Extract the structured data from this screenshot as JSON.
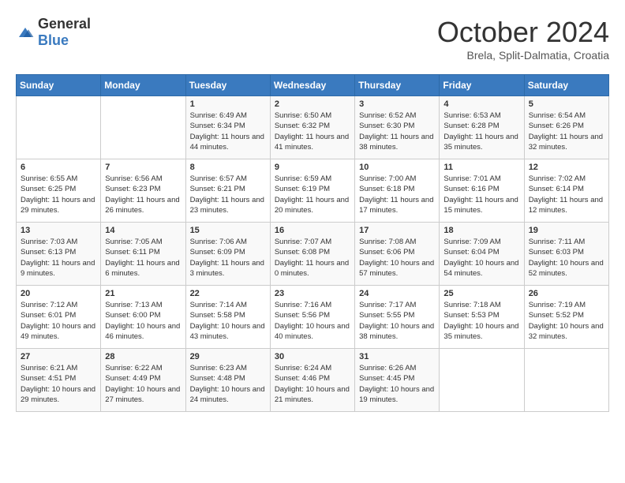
{
  "header": {
    "logo_general": "General",
    "logo_blue": "Blue",
    "month": "October 2024",
    "location": "Brela, Split-Dalmatia, Croatia"
  },
  "days_of_week": [
    "Sunday",
    "Monday",
    "Tuesday",
    "Wednesday",
    "Thursday",
    "Friday",
    "Saturday"
  ],
  "weeks": [
    [
      {
        "day": "",
        "content": ""
      },
      {
        "day": "",
        "content": ""
      },
      {
        "day": "1",
        "content": "Sunrise: 6:49 AM\nSunset: 6:34 PM\nDaylight: 11 hours and 44 minutes."
      },
      {
        "day": "2",
        "content": "Sunrise: 6:50 AM\nSunset: 6:32 PM\nDaylight: 11 hours and 41 minutes."
      },
      {
        "day": "3",
        "content": "Sunrise: 6:52 AM\nSunset: 6:30 PM\nDaylight: 11 hours and 38 minutes."
      },
      {
        "day": "4",
        "content": "Sunrise: 6:53 AM\nSunset: 6:28 PM\nDaylight: 11 hours and 35 minutes."
      },
      {
        "day": "5",
        "content": "Sunrise: 6:54 AM\nSunset: 6:26 PM\nDaylight: 11 hours and 32 minutes."
      }
    ],
    [
      {
        "day": "6",
        "content": "Sunrise: 6:55 AM\nSunset: 6:25 PM\nDaylight: 11 hours and 29 minutes."
      },
      {
        "day": "7",
        "content": "Sunrise: 6:56 AM\nSunset: 6:23 PM\nDaylight: 11 hours and 26 minutes."
      },
      {
        "day": "8",
        "content": "Sunrise: 6:57 AM\nSunset: 6:21 PM\nDaylight: 11 hours and 23 minutes."
      },
      {
        "day": "9",
        "content": "Sunrise: 6:59 AM\nSunset: 6:19 PM\nDaylight: 11 hours and 20 minutes."
      },
      {
        "day": "10",
        "content": "Sunrise: 7:00 AM\nSunset: 6:18 PM\nDaylight: 11 hours and 17 minutes."
      },
      {
        "day": "11",
        "content": "Sunrise: 7:01 AM\nSunset: 6:16 PM\nDaylight: 11 hours and 15 minutes."
      },
      {
        "day": "12",
        "content": "Sunrise: 7:02 AM\nSunset: 6:14 PM\nDaylight: 11 hours and 12 minutes."
      }
    ],
    [
      {
        "day": "13",
        "content": "Sunrise: 7:03 AM\nSunset: 6:13 PM\nDaylight: 11 hours and 9 minutes."
      },
      {
        "day": "14",
        "content": "Sunrise: 7:05 AM\nSunset: 6:11 PM\nDaylight: 11 hours and 6 minutes."
      },
      {
        "day": "15",
        "content": "Sunrise: 7:06 AM\nSunset: 6:09 PM\nDaylight: 11 hours and 3 minutes."
      },
      {
        "day": "16",
        "content": "Sunrise: 7:07 AM\nSunset: 6:08 PM\nDaylight: 11 hours and 0 minutes."
      },
      {
        "day": "17",
        "content": "Sunrise: 7:08 AM\nSunset: 6:06 PM\nDaylight: 10 hours and 57 minutes."
      },
      {
        "day": "18",
        "content": "Sunrise: 7:09 AM\nSunset: 6:04 PM\nDaylight: 10 hours and 54 minutes."
      },
      {
        "day": "19",
        "content": "Sunrise: 7:11 AM\nSunset: 6:03 PM\nDaylight: 10 hours and 52 minutes."
      }
    ],
    [
      {
        "day": "20",
        "content": "Sunrise: 7:12 AM\nSunset: 6:01 PM\nDaylight: 10 hours and 49 minutes."
      },
      {
        "day": "21",
        "content": "Sunrise: 7:13 AM\nSunset: 6:00 PM\nDaylight: 10 hours and 46 minutes."
      },
      {
        "day": "22",
        "content": "Sunrise: 7:14 AM\nSunset: 5:58 PM\nDaylight: 10 hours and 43 minutes."
      },
      {
        "day": "23",
        "content": "Sunrise: 7:16 AM\nSunset: 5:56 PM\nDaylight: 10 hours and 40 minutes."
      },
      {
        "day": "24",
        "content": "Sunrise: 7:17 AM\nSunset: 5:55 PM\nDaylight: 10 hours and 38 minutes."
      },
      {
        "day": "25",
        "content": "Sunrise: 7:18 AM\nSunset: 5:53 PM\nDaylight: 10 hours and 35 minutes."
      },
      {
        "day": "26",
        "content": "Sunrise: 7:19 AM\nSunset: 5:52 PM\nDaylight: 10 hours and 32 minutes."
      }
    ],
    [
      {
        "day": "27",
        "content": "Sunrise: 6:21 AM\nSunset: 4:51 PM\nDaylight: 10 hours and 29 minutes."
      },
      {
        "day": "28",
        "content": "Sunrise: 6:22 AM\nSunset: 4:49 PM\nDaylight: 10 hours and 27 minutes."
      },
      {
        "day": "29",
        "content": "Sunrise: 6:23 AM\nSunset: 4:48 PM\nDaylight: 10 hours and 24 minutes."
      },
      {
        "day": "30",
        "content": "Sunrise: 6:24 AM\nSunset: 4:46 PM\nDaylight: 10 hours and 21 minutes."
      },
      {
        "day": "31",
        "content": "Sunrise: 6:26 AM\nSunset: 4:45 PM\nDaylight: 10 hours and 19 minutes."
      },
      {
        "day": "",
        "content": ""
      },
      {
        "day": "",
        "content": ""
      }
    ]
  ]
}
